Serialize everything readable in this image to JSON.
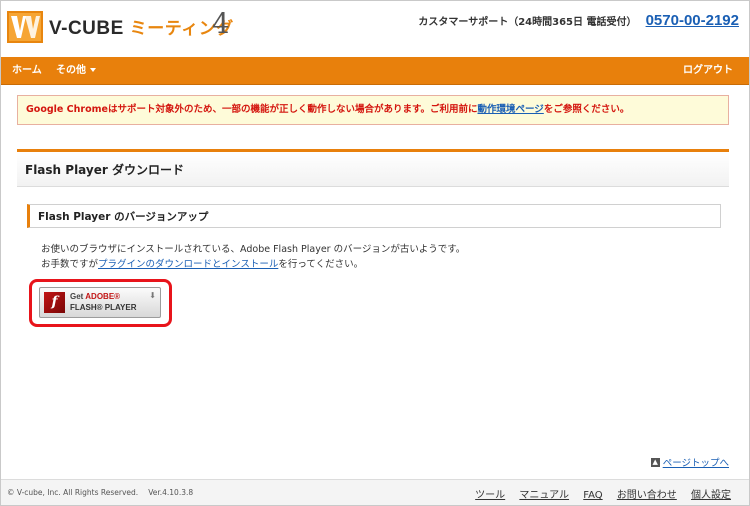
{
  "header": {
    "logo_vcube": "V-CUBE",
    "logo_meeting": "ミーティング",
    "logo_version": "4",
    "support_label": "カスタマーサポート（24時間365日 電話受付）",
    "support_phone": "0570-00-2192"
  },
  "nav": {
    "home": "ホーム",
    "other": "その他",
    "logout": "ログアウト"
  },
  "alert": {
    "text_before": "Google Chromeはサポート対象外のため、一部の機能が正しく動作しない場合があります。ご利用前に",
    "link": "動作環境ページ",
    "text_after": "をご参照ください。"
  },
  "page_title": "Flash Player ダウンロード",
  "section_title": "Flash Player のバージョンアップ",
  "message": {
    "line1": "お使いのブラウザにインストールされている、Adobe Flash Player のバージョンが古いようです。",
    "line2_before": "お手数ですが",
    "line2_link": "プラグインのダウンロードとインストール",
    "line2_after": "を行ってください。"
  },
  "flash_button": {
    "get": "Get",
    "adobe": "ADOBE®",
    "player": "FLASH® PLAYER"
  },
  "page_top": "ページトップへ",
  "footer": {
    "copyright": "© V-cube, Inc. All Rights Reserved.",
    "version": "Ver.4.10.3.8",
    "links": [
      "ツール",
      "マニュアル",
      "FAQ",
      "お問い合わせ",
      "個人設定"
    ]
  },
  "colors": {
    "accent": "#e8800c",
    "alert_text": "#d4160f",
    "link": "#1a5fb4",
    "highlight": "#e8141b"
  }
}
